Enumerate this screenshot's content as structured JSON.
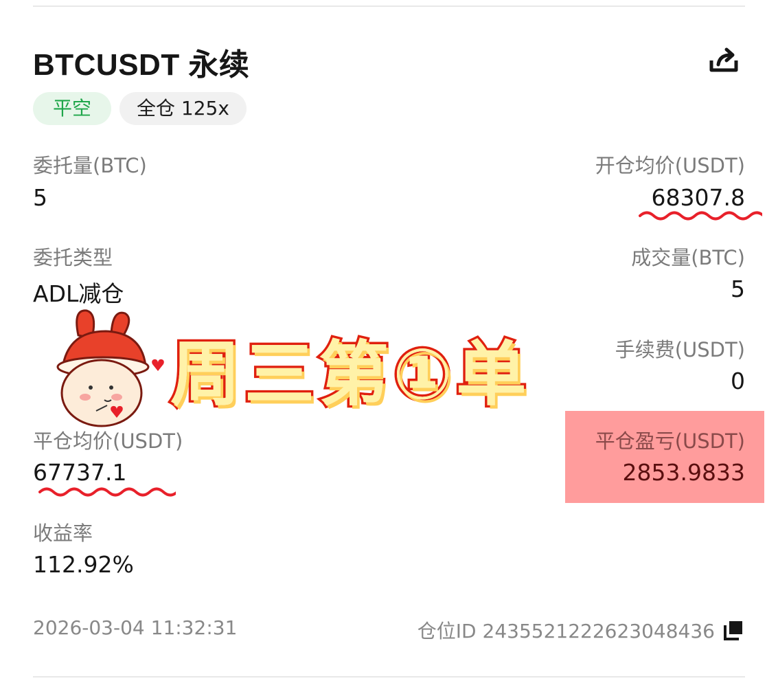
{
  "header": {
    "title": "BTCUSDT 永续",
    "share_icon": "share-icon"
  },
  "tags": {
    "side": "平空",
    "margin": "全仓 125x"
  },
  "fields": {
    "order_qty_label": "委托量(BTC)",
    "order_qty_value": "5",
    "open_price_label": "开仓均价(USDT)",
    "open_price_value": "68307.8",
    "order_type_label": "委托类型",
    "order_type_value": "ADL减仓",
    "filled_qty_label": "成交量(BTC)",
    "filled_qty_value": "5",
    "fee_label": "手续费(USDT)",
    "fee_value": "0",
    "close_price_label": "平仓均价(USDT)",
    "close_price_value": "67737.1",
    "pnl_label": "平仓盈亏(USDT)",
    "pnl_value": "2853.9833",
    "roi_label": "收益率",
    "roi_value": "112.92%"
  },
  "footer": {
    "timestamp": "2026-03-04 11:32:31",
    "position_id": "仓位ID 2435521222623048436",
    "copy_icon": "copy-icon"
  },
  "overlay": {
    "sticker_text": "周三第①单"
  },
  "colors": {
    "green": "#1fa64a",
    "pnl_highlight": "#ff9c9c",
    "squiggle": "#e8202a"
  }
}
